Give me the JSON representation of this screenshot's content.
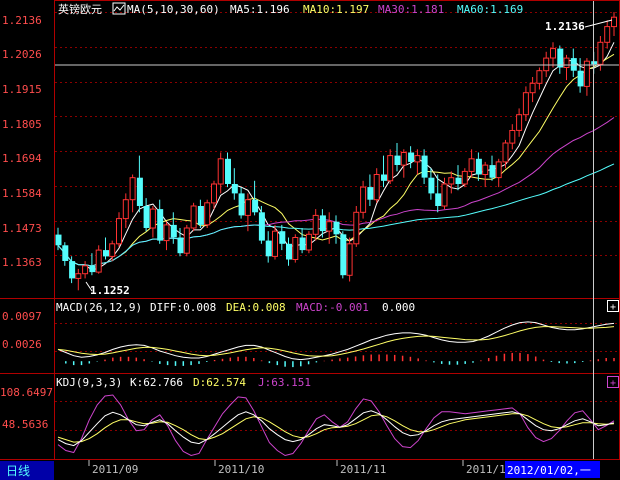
{
  "colors": {
    "up": "#ff3232",
    "down": "#54fcfc",
    "grid": "#8b0000",
    "frame": "#b00000",
    "axis_text": "#ff4d4d",
    "date_text": "#c0c0c0",
    "white": "#ffffff",
    "ma5": "#ffffff",
    "ma10": "#ffff66",
    "ma30": "#cc44cc",
    "ma60": "#54fcfc",
    "diff": "#ffffff",
    "dea": "#ffff66",
    "macd": "#cc44cc",
    "k": "#ffffff",
    "d": "#ffff66",
    "j": "#cc44cc",
    "period_bg": "#0000a8",
    "date_box": "#0000ff"
  },
  "panels": {
    "main": {
      "instrument": "英镑欧元",
      "ma_label": "MA(5,10,30,60)",
      "ma5": "MA5:1.196",
      "ma10": "MA10:1.197",
      "ma30": "MA30:1.181",
      "ma60": "MA60:1.169",
      "max_label": "1.2136",
      "min_label": "1.1252"
    },
    "macd": {
      "label": "MACD(26,12,9)",
      "diff": "DIFF:0.008",
      "dea": "DEA:0.008",
      "macd": "MACD:-0.001",
      "extra": "0.000"
    },
    "kdj": {
      "label": "KDJ(9,3,3)",
      "k": "K:62.766",
      "d": "D:62.574",
      "j": "J:63.151"
    }
  },
  "footer": {
    "period": "日线",
    "cursor_date": "2012/01/02,一",
    "months": [
      "2011/09",
      "2011/10",
      "2011/11",
      "2011/1"
    ]
  },
  "chart_data": [
    {
      "type": "candlestick",
      "title": "英镑欧元",
      "yticks": [
        "1.2136",
        "1.2026",
        "1.1915",
        "1.1805",
        "1.1694",
        "1.1584",
        "1.1473",
        "1.1363"
      ],
      "ylim": [
        1.1234,
        1.2165
      ],
      "candles": [
        [
          1.1429,
          1.1451,
          1.138,
          1.1395
        ],
        [
          1.1395,
          1.1405,
          1.133,
          1.1345
        ],
        [
          1.1345,
          1.136,
          1.1275,
          1.129
        ],
        [
          1.129,
          1.132,
          1.1252,
          1.1305
        ],
        [
          1.1305,
          1.1345,
          1.129,
          1.133
        ],
        [
          1.133,
          1.137,
          1.13,
          1.131
        ],
        [
          1.131,
          1.1395,
          1.1305,
          1.138
        ],
        [
          1.138,
          1.142,
          1.135,
          1.136
        ],
        [
          1.136,
          1.141,
          1.1345,
          1.14
        ],
        [
          1.14,
          1.15,
          1.139,
          1.148
        ],
        [
          1.148,
          1.156,
          1.145,
          1.154
        ],
        [
          1.154,
          1.162,
          1.15,
          1.161
        ],
        [
          1.161,
          1.168,
          1.15,
          1.152
        ],
        [
          1.152,
          1.1545,
          1.144,
          1.145
        ],
        [
          1.145,
          1.152,
          1.142,
          1.151
        ],
        [
          1.151,
          1.154,
          1.14,
          1.141
        ],
        [
          1.141,
          1.147,
          1.138,
          1.146
        ],
        [
          1.146,
          1.15,
          1.14,
          1.142
        ],
        [
          1.142,
          1.145,
          1.136,
          1.137
        ],
        [
          1.137,
          1.146,
          1.136,
          1.145
        ],
        [
          1.145,
          1.153,
          1.144,
          1.152
        ],
        [
          1.152,
          1.154,
          1.145,
          1.146
        ],
        [
          1.146,
          1.154,
          1.145,
          1.153
        ],
        [
          1.153,
          1.16,
          1.151,
          1.159
        ],
        [
          1.159,
          1.169,
          1.156,
          1.167
        ],
        [
          1.167,
          1.169,
          1.158,
          1.159
        ],
        [
          1.159,
          1.164,
          1.154,
          1.156
        ],
        [
          1.156,
          1.158,
          1.148,
          1.149
        ],
        [
          1.149,
          1.156,
          1.144,
          1.154
        ],
        [
          1.154,
          1.16,
          1.149,
          1.15
        ],
        [
          1.15,
          1.152,
          1.14,
          1.141
        ],
        [
          1.141,
          1.144,
          1.134,
          1.136
        ],
        [
          1.136,
          1.146,
          1.135,
          1.144
        ],
        [
          1.144,
          1.146,
          1.138,
          1.14
        ],
        [
          1.14,
          1.142,
          1.133,
          1.135
        ],
        [
          1.135,
          1.143,
          1.134,
          1.142
        ],
        [
          1.142,
          1.145,
          1.137,
          1.138
        ],
        [
          1.138,
          1.144,
          1.137,
          1.143
        ],
        [
          1.143,
          1.151,
          1.141,
          1.149
        ],
        [
          1.149,
          1.151,
          1.142,
          1.144
        ],
        [
          1.144,
          1.15,
          1.14,
          1.147
        ],
        [
          1.147,
          1.149,
          1.14,
          1.143
        ],
        [
          1.143,
          1.144,
          1.129,
          1.13
        ],
        [
          1.13,
          1.142,
          1.128,
          1.14
        ],
        [
          1.14,
          1.152,
          1.139,
          1.15
        ],
        [
          1.15,
          1.16,
          1.148,
          1.158
        ],
        [
          1.158,
          1.162,
          1.152,
          1.154
        ],
        [
          1.154,
          1.164,
          1.153,
          1.162
        ],
        [
          1.162,
          1.168,
          1.158,
          1.16
        ],
        [
          1.16,
          1.17,
          1.159,
          1.168
        ],
        [
          1.168,
          1.172,
          1.163,
          1.165
        ],
        [
          1.165,
          1.17,
          1.161,
          1.169
        ],
        [
          1.169,
          1.171,
          1.164,
          1.166
        ],
        [
          1.166,
          1.17,
          1.162,
          1.168
        ],
        [
          1.168,
          1.17,
          1.159,
          1.161
        ],
        [
          1.161,
          1.164,
          1.154,
          1.156
        ],
        [
          1.156,
          1.162,
          1.15,
          1.152
        ],
        [
          1.152,
          1.161,
          1.151,
          1.159
        ],
        [
          1.159,
          1.163,
          1.156,
          1.161
        ],
        [
          1.161,
          1.165,
          1.157,
          1.159
        ],
        [
          1.159,
          1.164,
          1.158,
          1.163
        ],
        [
          1.163,
          1.17,
          1.161,
          1.167
        ],
        [
          1.167,
          1.169,
          1.16,
          1.162
        ],
        [
          1.162,
          1.166,
          1.158,
          1.165
        ],
        [
          1.165,
          1.168,
          1.16,
          1.161
        ],
        [
          1.161,
          1.167,
          1.158,
          1.166
        ],
        [
          1.166,
          1.173,
          1.164,
          1.172
        ],
        [
          1.172,
          1.178,
          1.17,
          1.176
        ],
        [
          1.176,
          1.183,
          1.174,
          1.181
        ],
        [
          1.181,
          1.19,
          1.179,
          1.188
        ],
        [
          1.188,
          1.193,
          1.185,
          1.191
        ],
        [
          1.191,
          1.196,
          1.189,
          1.195
        ],
        [
          1.195,
          1.201,
          1.193,
          1.199
        ],
        [
          1.199,
          1.204,
          1.196,
          1.202
        ],
        [
          1.202,
          1.203,
          1.194,
          1.196
        ],
        [
          1.196,
          1.2,
          1.192,
          1.199
        ],
        [
          1.199,
          1.202,
          1.193,
          1.195
        ],
        [
          1.195,
          1.199,
          1.188,
          1.19
        ],
        [
          1.19,
          1.199,
          1.187,
          1.198
        ],
        [
          1.198,
          1.201,
          1.194,
          1.197
        ],
        [
          1.197,
          1.206,
          1.195,
          1.204
        ],
        [
          1.204,
          1.211,
          1.202,
          1.209
        ],
        [
          1.209,
          1.2136,
          1.206,
          1.212
        ]
      ]
    },
    {
      "type": "line",
      "title": "MACD(26,12,9)",
      "yticks": [
        "0.0097",
        "0.0026"
      ],
      "ylim": [
        -0.0025,
        0.012
      ],
      "series": [
        {
          "name": "DIFF",
          "values": [
            0.003,
            0.0022,
            0.0014,
            0.001,
            0.0012,
            0.0016,
            0.0022,
            0.003,
            0.0036,
            0.004,
            0.0042,
            0.004,
            0.0034,
            0.0026,
            0.002,
            0.0014,
            0.001,
            0.0008,
            0.0008,
            0.0012,
            0.0018,
            0.0024,
            0.003,
            0.0036,
            0.004,
            0.004,
            0.0036,
            0.0028,
            0.002,
            0.0012,
            0.0006,
            0.0004,
            0.0006,
            0.001,
            0.0014,
            0.0018,
            0.0024,
            0.003,
            0.0038,
            0.0046,
            0.0054,
            0.006,
            0.0066,
            0.007,
            0.0072,
            0.0072,
            0.007,
            0.0066,
            0.006,
            0.0054,
            0.005,
            0.0048,
            0.0048,
            0.005,
            0.0056,
            0.0064,
            0.0074,
            0.0084,
            0.0092,
            0.0098,
            0.01,
            0.0098,
            0.0092,
            0.0086,
            0.0082,
            0.008,
            0.008,
            0.0082,
            0.0086,
            0.009,
            0.0094,
            0.0096
          ]
        },
        {
          "name": "DEA",
          "values": [
            0.003,
            0.0028,
            0.0024,
            0.002,
            0.0018,
            0.0017,
            0.0018,
            0.0021,
            0.0025,
            0.0029,
            0.0033,
            0.0035,
            0.0035,
            0.0033,
            0.003,
            0.0026,
            0.0022,
            0.0018,
            0.0015,
            0.0014,
            0.0015,
            0.0018,
            0.0021,
            0.0025,
            0.0029,
            0.0032,
            0.0034,
            0.0033,
            0.003,
            0.0026,
            0.0021,
            0.0017,
            0.0014,
            0.0013,
            0.0013,
            0.0014,
            0.0017,
            0.0021,
            0.0026,
            0.0031,
            0.0037,
            0.0043,
            0.0049,
            0.0054,
            0.0058,
            0.0061,
            0.0063,
            0.0064,
            0.0063,
            0.0061,
            0.0059,
            0.0057,
            0.0055,
            0.0054,
            0.0054,
            0.0056,
            0.006,
            0.0065,
            0.0071,
            0.0077,
            0.0082,
            0.0086,
            0.0088,
            0.0088,
            0.0087,
            0.0086,
            0.0085,
            0.0084,
            0.0084,
            0.0085,
            0.0086,
            0.0088
          ]
        },
        {
          "name": "MACD",
          "values": [
            0.0,
            -0.0006,
            -0.001,
            -0.001,
            -0.0006,
            -0.0001,
            0.0004,
            0.0009,
            0.0011,
            0.0011,
            0.0009,
            0.0005,
            -0.0001,
            -0.0007,
            -0.001,
            -0.0012,
            -0.0012,
            -0.001,
            -0.0007,
            -0.0002,
            0.0003,
            0.0006,
            0.0009,
            0.0011,
            0.0011,
            0.0008,
            0.0002,
            -0.0005,
            -0.001,
            -0.0014,
            -0.0015,
            -0.0013,
            -0.0008,
            -0.0003,
            0.0001,
            0.0004,
            0.0007,
            0.0009,
            0.0012,
            0.0015,
            0.0017,
            0.0017,
            0.0017,
            0.0016,
            0.0014,
            0.0011,
            0.0007,
            0.0002,
            -0.0003,
            -0.0007,
            -0.0009,
            -0.0009,
            -0.0007,
            -0.0004,
            0.0002,
            0.0008,
            0.0014,
            0.0019,
            0.0021,
            0.0021,
            0.0018,
            0.0012,
            0.0004,
            -0.0002,
            -0.0005,
            -0.0006,
            -0.0005,
            -0.0002,
            0.0002,
            0.0005,
            0.0008,
            0.0008
          ]
        }
      ]
    },
    {
      "type": "line",
      "title": "KDJ(9,3,3)",
      "yticks": [
        "108.6497",
        "48.5636"
      ],
      "ylim": [
        -5,
        130
      ],
      "series": [
        {
          "name": "K",
          "values": [
            30,
            22,
            18,
            28,
            45,
            62,
            78,
            85,
            80,
            70,
            60,
            58,
            65,
            70,
            62,
            48,
            35,
            25,
            22,
            30,
            42,
            55,
            68,
            80,
            86,
            80,
            68,
            52,
            40,
            30,
            26,
            30,
            40,
            52,
            60,
            58,
            55,
            60,
            72,
            84,
            88,
            82,
            70,
            56,
            44,
            38,
            40,
            48,
            58,
            66,
            70,
            72,
            74,
            76,
            78,
            80,
            82,
            84,
            86,
            82,
            70,
            58,
            50,
            48,
            52,
            60,
            68,
            72,
            66,
            58,
            60,
            64
          ]
        },
        {
          "name": "D",
          "values": [
            35,
            30,
            25,
            26,
            32,
            42,
            54,
            64,
            70,
            70,
            66,
            62,
            63,
            66,
            65,
            58,
            50,
            40,
            32,
            30,
            35,
            42,
            52,
            62,
            72,
            76,
            74,
            66,
            56,
            46,
            38,
            34,
            36,
            42,
            50,
            54,
            55,
            57,
            62,
            70,
            78,
            80,
            76,
            68,
            58,
            50,
            46,
            46,
            50,
            56,
            62,
            66,
            70,
            72,
            74,
            76,
            78,
            80,
            82,
            82,
            78,
            70,
            62,
            56,
            54,
            56,
            60,
            64,
            64,
            62,
            61,
            62
          ]
        },
        {
          "name": "J",
          "values": [
            20,
            8,
            4,
            32,
            70,
            100,
            118,
            120,
            100,
            70,
            48,
            50,
            70,
            80,
            58,
            28,
            6,
            -2,
            2,
            30,
            56,
            82,
            100,
            116,
            114,
            88,
            56,
            24,
            8,
            -2,
            2,
            22,
            48,
            72,
            80,
            66,
            55,
            66,
            92,
            112,
            108,
            86,
            58,
            32,
            16,
            14,
            28,
            52,
            74,
            86,
            86,
            84,
            82,
            84,
            86,
            88,
            90,
            92,
            94,
            82,
            54,
            34,
            26,
            32,
            48,
            68,
            84,
            88,
            70,
            50,
            58,
            68
          ]
        }
      ]
    }
  ]
}
